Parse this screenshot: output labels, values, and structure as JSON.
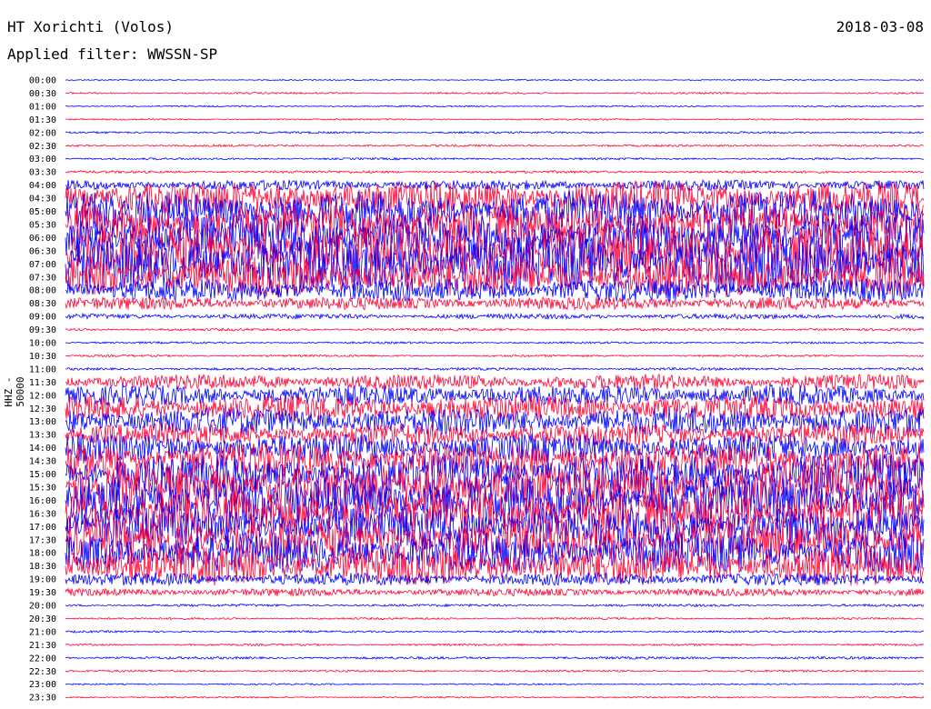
{
  "header": {
    "station": "HT Xorichti (Volos)",
    "filter": "Applied filter: WWSSN-SP",
    "date": "2018-03-08"
  },
  "colors": {
    "even_trace": "#0000ff",
    "odd_trace": "#ff0033",
    "text": "#000000"
  },
  "chart_data": {
    "type": "line",
    "title": "HT Xorichti (Volos)",
    "subtitle": "Applied filter: WWSSN-SP",
    "ylabel": "HHZ - 50000",
    "xlabel": "",
    "date": "2018-03-08",
    "grid": false,
    "rows": [
      {
        "label": "00:00",
        "amp": 0.05
      },
      {
        "label": "00:30",
        "amp": 0.07
      },
      {
        "label": "01:00",
        "amp": 0.06
      },
      {
        "label": "01:30",
        "amp": 0.06
      },
      {
        "label": "02:00",
        "amp": 0.08
      },
      {
        "label": "02:30",
        "amp": 0.08
      },
      {
        "label": "03:00",
        "amp": 0.08
      },
      {
        "label": "03:30",
        "amp": 0.1
      },
      {
        "label": "04:00",
        "amp": 0.4
      },
      {
        "label": "04:30",
        "amp": 1.3
      },
      {
        "label": "05:00",
        "amp": 1.6
      },
      {
        "label": "05:30",
        "amp": 1.6
      },
      {
        "label": "06:00",
        "amp": 1.8
      },
      {
        "label": "06:30",
        "amp": 2.0
      },
      {
        "label": "07:00",
        "amp": 2.2
      },
      {
        "label": "07:30",
        "amp": 1.6
      },
      {
        "label": "08:00",
        "amp": 0.9
      },
      {
        "label": "08:30",
        "amp": 0.5
      },
      {
        "label": "09:00",
        "amp": 0.2
      },
      {
        "label": "09:30",
        "amp": 0.1
      },
      {
        "label": "10:00",
        "amp": 0.08
      },
      {
        "label": "10:30",
        "amp": 0.08
      },
      {
        "label": "11:00",
        "amp": 0.1
      },
      {
        "label": "11:30",
        "amp": 0.6
      },
      {
        "label": "12:00",
        "amp": 0.8
      },
      {
        "label": "12:30",
        "amp": 1.0
      },
      {
        "label": "13:00",
        "amp": 1.1
      },
      {
        "label": "13:30",
        "amp": 0.9
      },
      {
        "label": "14:00",
        "amp": 1.1
      },
      {
        "label": "14:30",
        "amp": 1.4
      },
      {
        "label": "15:00",
        "amp": 1.6
      },
      {
        "label": "15:30",
        "amp": 1.8
      },
      {
        "label": "16:00",
        "amp": 1.9
      },
      {
        "label": "16:30",
        "amp": 1.7
      },
      {
        "label": "17:00",
        "amp": 1.6
      },
      {
        "label": "17:30",
        "amp": 1.6
      },
      {
        "label": "18:00",
        "amp": 1.6
      },
      {
        "label": "18:30",
        "amp": 1.5
      },
      {
        "label": "19:00",
        "amp": 0.5
      },
      {
        "label": "19:30",
        "amp": 0.3
      },
      {
        "label": "20:00",
        "amp": 0.1
      },
      {
        "label": "20:30",
        "amp": 0.08
      },
      {
        "label": "21:00",
        "amp": 0.08
      },
      {
        "label": "21:30",
        "amp": 0.08
      },
      {
        "label": "22:00",
        "amp": 0.1
      },
      {
        "label": "22:30",
        "amp": 0.08
      },
      {
        "label": "23:00",
        "amp": 0.06
      },
      {
        "label": "23:30",
        "amp": 0.06
      }
    ]
  }
}
